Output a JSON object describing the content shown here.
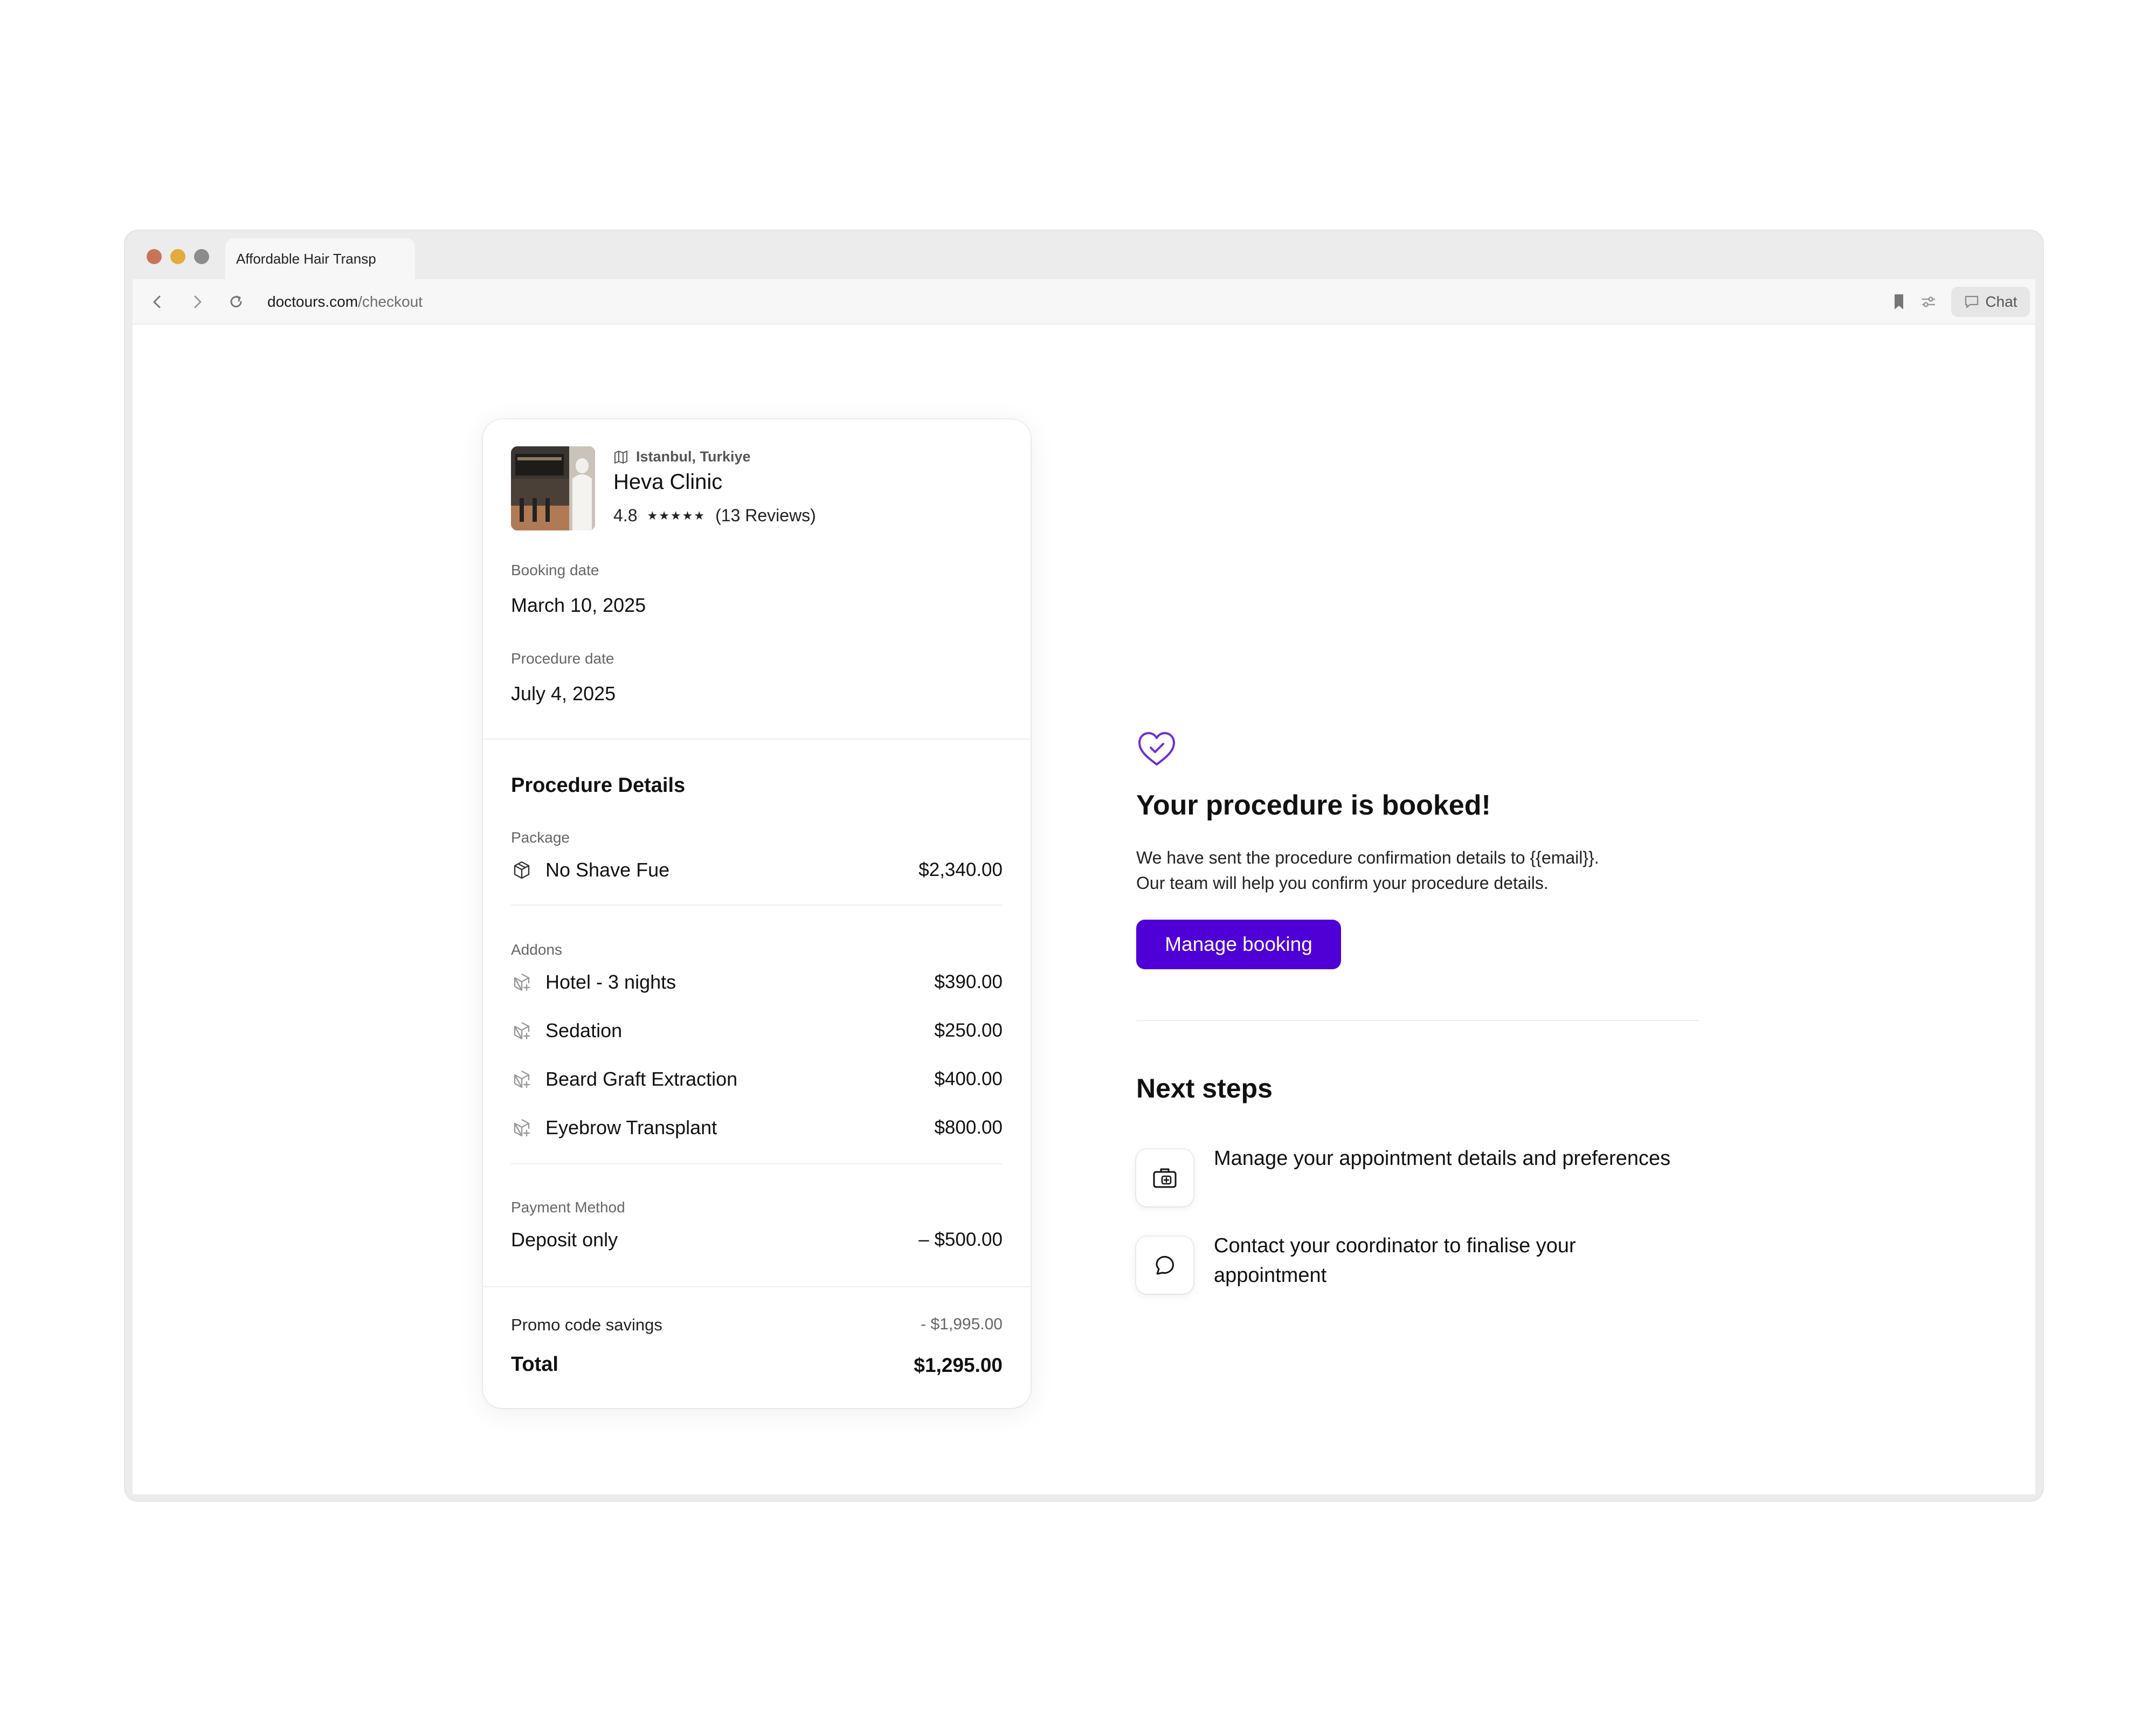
{
  "browser": {
    "tab_title": "Affordable Hair Transp",
    "url_domain": "doctours.com",
    "url_path": "/checkout",
    "chat_label": "Chat"
  },
  "clinic": {
    "location": "Istanbul, Turkiye",
    "name": "Heva Clinic",
    "rating": "4.8",
    "stars": "★★★★★",
    "reviews": "(13 Reviews)"
  },
  "booking": {
    "booking_date_label": "Booking date",
    "booking_date": "March 10, 2025",
    "procedure_date_label": "Procedure date",
    "procedure_date": "July 4, 2025"
  },
  "procedure_details": {
    "title": "Procedure Details",
    "package_label": "Package",
    "package": {
      "name": "No Shave Fue",
      "price": "$2,340.00"
    },
    "addons_label": "Addons",
    "addons": [
      {
        "name": "Hotel - 3 nights",
        "price": "$390.00"
      },
      {
        "name": "Sedation",
        "price": "$250.00"
      },
      {
        "name": "Beard Graft Extraction",
        "price": "$400.00"
      },
      {
        "name": "Eyebrow Transplant",
        "price": "$800.00"
      }
    ],
    "payment_label": "Payment Method",
    "payment": {
      "name": "Deposit only",
      "price": "– $500.00"
    }
  },
  "summary": {
    "promo_label": "Promo code savings",
    "promo_value": "- $1,995.00",
    "total_label": "Total",
    "total_value": "$1,295.00"
  },
  "confirmation": {
    "title": "Your procedure is booked!",
    "message_line1": "We have sent the procedure confirmation details to {{email}}.",
    "message_line2": "Our team will help you confirm your procedure details.",
    "button_label": "Manage booking"
  },
  "next_steps": {
    "title": "Next steps",
    "items": [
      {
        "text": "Manage your appointment details and preferences",
        "icon": "briefcase-icon"
      },
      {
        "text": "Contact your coordinator to finalise your appointment",
        "icon": "chat-bubble-icon"
      }
    ]
  },
  "colors": {
    "accent": "#4e00d6",
    "heart": "#6b2fd8"
  }
}
